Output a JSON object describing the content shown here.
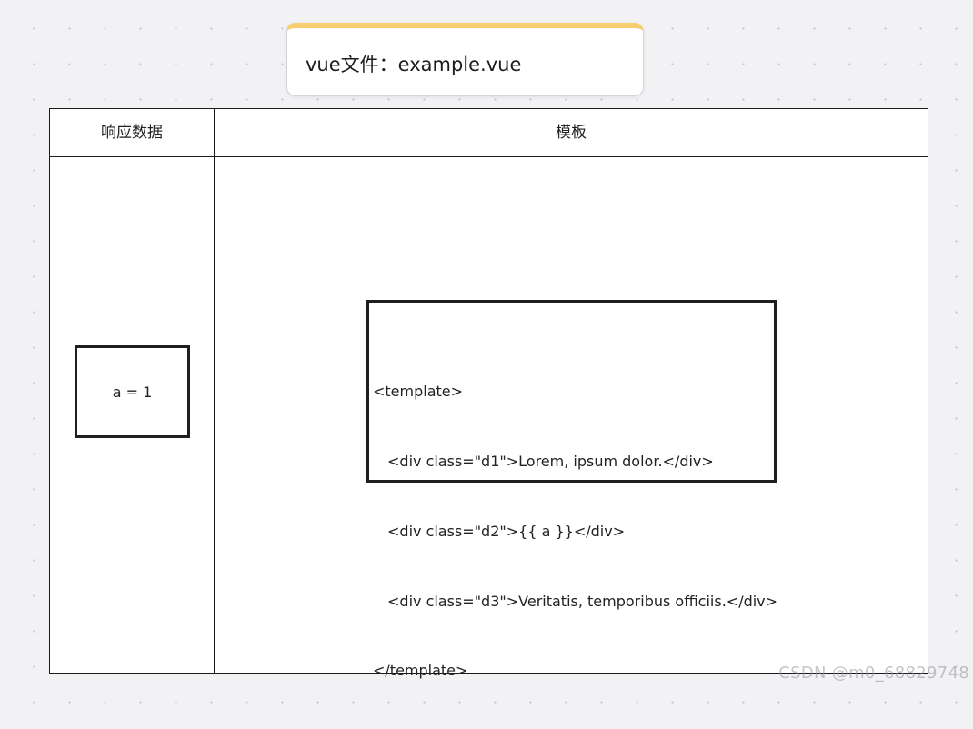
{
  "title": "vue文件：example.vue",
  "table": {
    "header_left": "响应数据",
    "header_right": "模板"
  },
  "data_box": {
    "text": "a = 1"
  },
  "template_code": {
    "line1": "<template>",
    "line2": "<div class=\"d1\">Lorem, ipsum dolor.</div>",
    "line3": "<div class=\"d2\">{{ a }}</div>",
    "line4": "<div class=\"d3\">Veritatis, temporibus officiis.</div>",
    "line5": "</template>"
  },
  "watermark": "CSDN @m0_68829748",
  "colors": {
    "accent": "#f7cd71",
    "canvas": "#f2f2f4",
    "border": "#1a1a1a"
  }
}
